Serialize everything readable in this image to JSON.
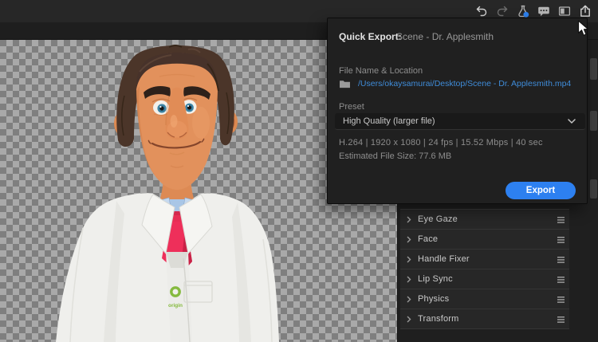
{
  "toolbar": {
    "icons": [
      {
        "name": "undo-icon"
      },
      {
        "name": "redo-icon"
      },
      {
        "name": "test-flask-icon",
        "badge_color": "#2e82f0"
      },
      {
        "name": "feedback-comments-icon"
      },
      {
        "name": "workspace-panel-icon"
      },
      {
        "name": "share-export-icon"
      }
    ]
  },
  "quick_export": {
    "title": "Quick Export:",
    "scene_name": "Scene - Dr. Applesmith",
    "file_section_label": "File Name & Location",
    "file_path": "/Users/okaysamurai/Desktop/Scene - Dr. Applesmith.mp4",
    "preset_label": "Preset",
    "preset_value": "High Quality (larger file)",
    "specs_line": "H.264 | 1920 x 1080 | 24 fps | 15.52 Mbps | 40 sec",
    "estimated_file_size": "Estimated File Size: 77.6 MB",
    "export_button_label": "Export"
  },
  "properties_panel": {
    "rows": [
      {
        "label": "Eye Gaze"
      },
      {
        "label": "Face"
      },
      {
        "label": "Handle Fixer"
      },
      {
        "label": "Lip Sync"
      },
      {
        "label": "Physics"
      },
      {
        "label": "Transform"
      }
    ]
  },
  "scene": {
    "coat_badge_text": "origin"
  },
  "colors": {
    "accent_blue": "#2d80f0",
    "link_blue": "#3f8cd9",
    "checker_light": "#a9a9a9",
    "checker_dark": "#7f7f7f",
    "tie_red": "#ee2f5a",
    "badge_green": "#85ba3f"
  }
}
